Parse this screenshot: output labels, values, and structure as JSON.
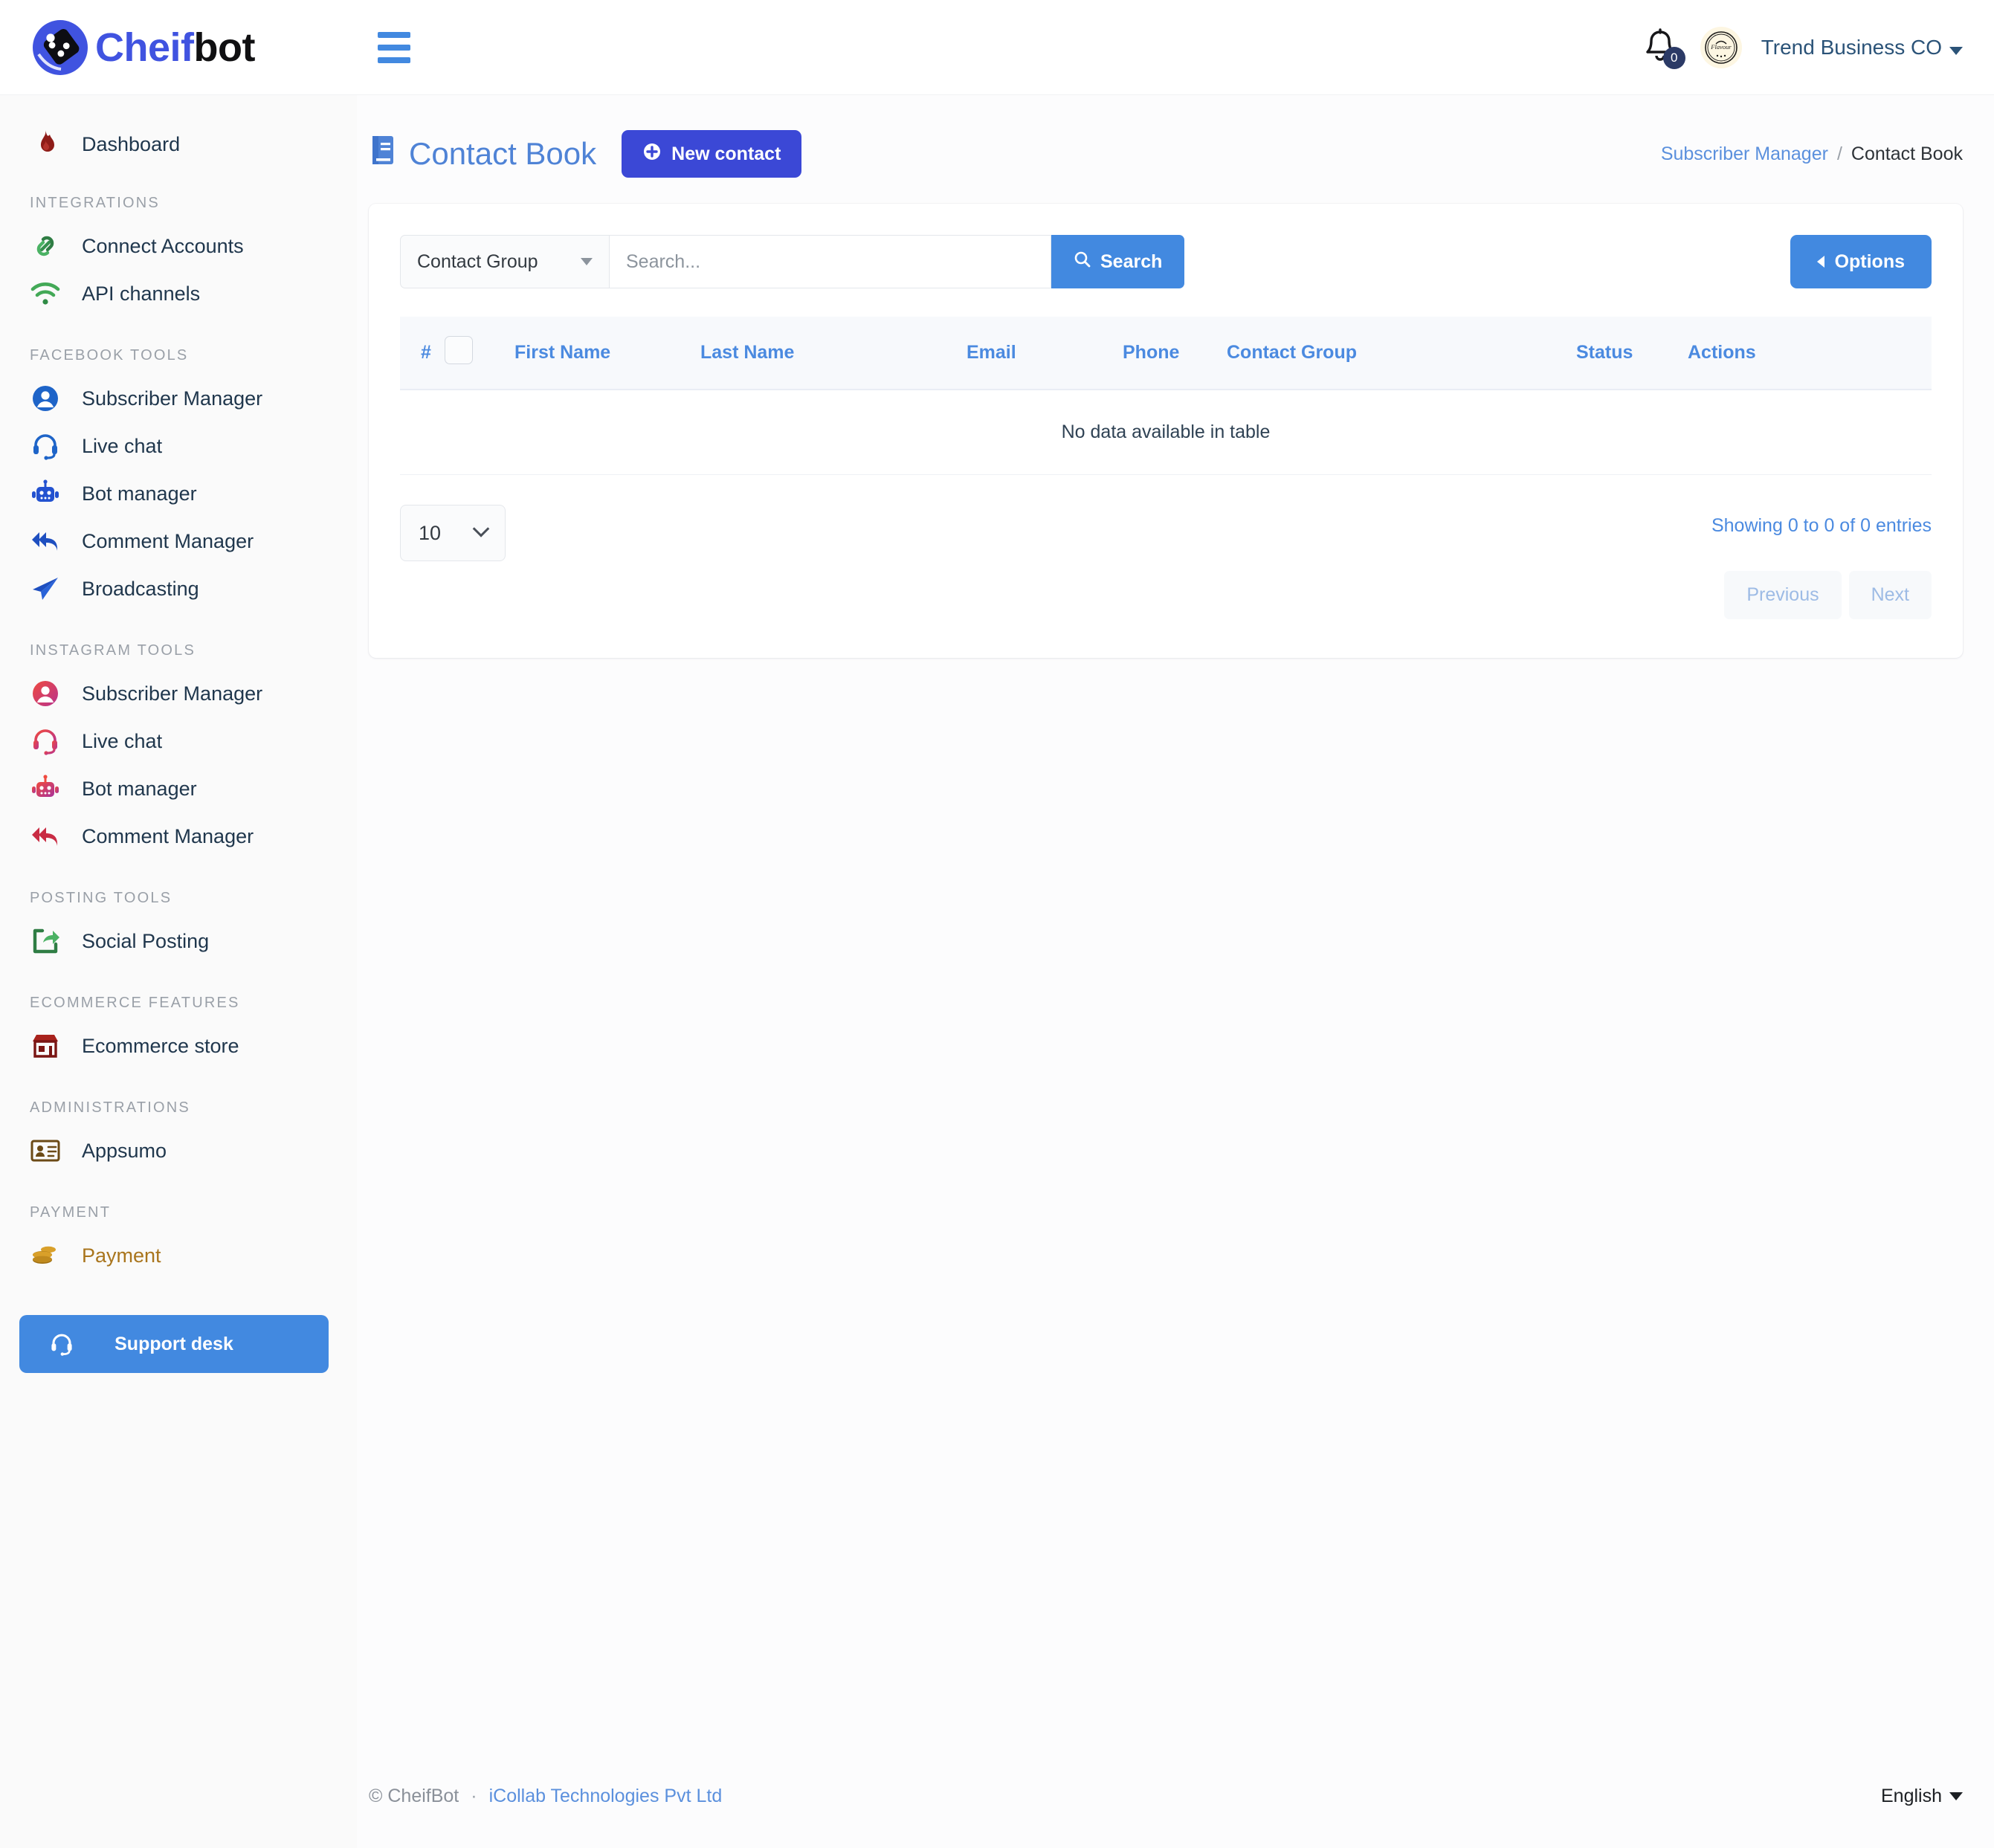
{
  "brand": {
    "name_part1": "Cheif",
    "name_part2": "bot",
    "logo_icon": "cheifbot-logo-icon"
  },
  "topbar": {
    "menu_toggle_icon": "hamburger-menu-icon",
    "notification_icon": "bell-icon",
    "notification_count": "0",
    "avatar_icon": "flavour-brand-avatar",
    "avatar_label": "Flavour",
    "user_name": "Trend Business CO",
    "user_caret_icon": "chevron-down-icon"
  },
  "sidebar": {
    "groups": [
      {
        "title": "",
        "items": [
          {
            "label": "Dashboard",
            "icon": "flame-icon",
            "color": "#8e1c18"
          }
        ]
      },
      {
        "title": "INTEGRATIONS",
        "items": [
          {
            "label": "Connect Accounts",
            "icon": "link-chain-icon",
            "color": "#36914e"
          },
          {
            "label": "API channels",
            "icon": "wifi-icon",
            "color": "#43a957"
          }
        ]
      },
      {
        "title": "FACEBOOK TOOLS",
        "items": [
          {
            "label": "Subscriber Manager",
            "icon": "user-circle-icon",
            "color": "#1e64c8"
          },
          {
            "label": "Live chat",
            "icon": "headset-icon",
            "color": "#1e64c8"
          },
          {
            "label": "Bot manager",
            "icon": "robot-icon",
            "color": "#2352d0"
          },
          {
            "label": "Comment Manager",
            "icon": "reply-all-icon",
            "color": "#1e4fc0"
          },
          {
            "label": "Broadcasting",
            "icon": "paper-plane-icon",
            "color": "#1e4fc0"
          }
        ]
      },
      {
        "title": "INSTAGRAM TOOLS",
        "items": [
          {
            "label": "Subscriber Manager",
            "icon": "user-circle-icon",
            "color": "#d43a6a"
          },
          {
            "label": "Live chat",
            "icon": "headset-icon",
            "color": "#d43a6a"
          },
          {
            "label": "Bot manager",
            "icon": "robot-icon",
            "color": "#d7452f"
          },
          {
            "label": "Comment Manager",
            "icon": "reply-all-icon",
            "color": "#c92c44"
          }
        ]
      },
      {
        "title": "POSTING TOOLS",
        "items": [
          {
            "label": "Social Posting",
            "icon": "share-square-icon",
            "color": "#3a9c4e"
          }
        ]
      },
      {
        "title": "ECOMMERCE FEATURES",
        "items": [
          {
            "label": "Ecommerce store",
            "icon": "store-icon",
            "color": "#a8221c"
          }
        ]
      },
      {
        "title": "ADMINISTRATIONS",
        "items": [
          {
            "label": "Appsumo",
            "icon": "id-card-icon",
            "color": "#6b4a16"
          }
        ]
      },
      {
        "title": "PAYMENT",
        "items": [
          {
            "label": "Payment",
            "icon": "coins-icon",
            "color": "#c08a1e",
            "active": true
          }
        ]
      }
    ],
    "support_button": {
      "label": "Support desk",
      "icon": "headset-icon"
    }
  },
  "page": {
    "title": "Contact Book",
    "title_icon": "book-icon",
    "new_button": {
      "label": "New contact",
      "icon": "plus-circle-icon"
    },
    "breadcrumb": {
      "parent": "Subscriber Manager",
      "separator": "/",
      "current": "Contact Book"
    }
  },
  "filters": {
    "group_select": {
      "value": "Contact Group",
      "caret_icon": "caret-down-icon"
    },
    "search": {
      "placeholder": "Search...",
      "value": ""
    },
    "search_button": {
      "label": "Search",
      "icon": "search-icon"
    },
    "options_button": {
      "label": "Options",
      "icon": "caret-left-icon"
    }
  },
  "table": {
    "columns": [
      "#",
      "",
      "First Name",
      "Last Name",
      "Email",
      "Phone",
      "Contact Group",
      "",
      "Status",
      "Actions"
    ],
    "select_all_checkbox": "select-all-checkbox",
    "rows": [],
    "empty_message": "No data available in table"
  },
  "pagination": {
    "page_length": "10",
    "length_chevron_icon": "chevron-down-icon",
    "entries_info": "Showing 0 to 0 of 0 entries",
    "previous_label": "Previous",
    "next_label": "Next"
  },
  "footer": {
    "copyright": "© CheifBot",
    "dot": "·",
    "company": "iCollab Technologies Pvt Ltd",
    "language": "English",
    "language_caret_icon": "chevron-down-icon"
  }
}
